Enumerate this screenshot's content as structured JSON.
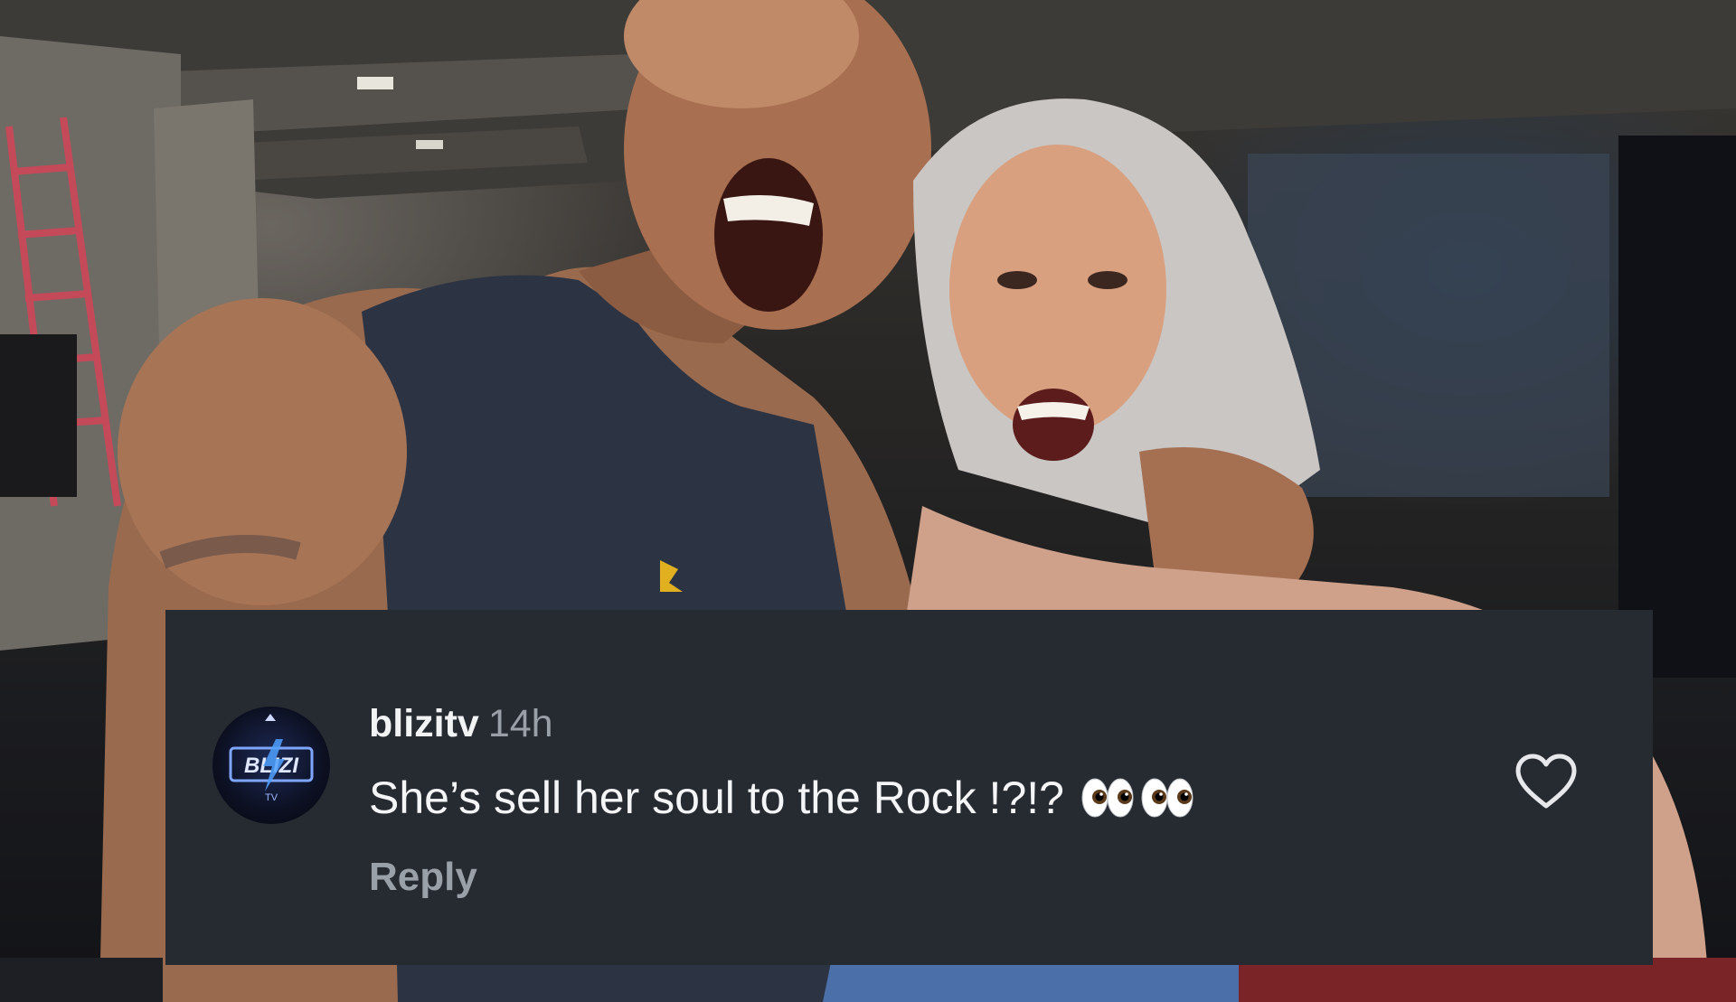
{
  "comment": {
    "username": "blizitv",
    "timestamp": "14h",
    "text": "She’s sell her soul to the Rock !?!?",
    "reply_label": "Reply",
    "avatar_logo_text": "BLIZI",
    "avatar_sub_text": "TV"
  },
  "icons": {
    "avatar": "blizitv-logo-icon",
    "emoji": "eyes-emoji-icon",
    "like": "heart-outline-icon"
  },
  "colors": {
    "panel_bg": "#262a31",
    "username": "#f2f3f5",
    "muted_text": "#9aa0a8",
    "heart_stroke": "#e6e8ec"
  }
}
